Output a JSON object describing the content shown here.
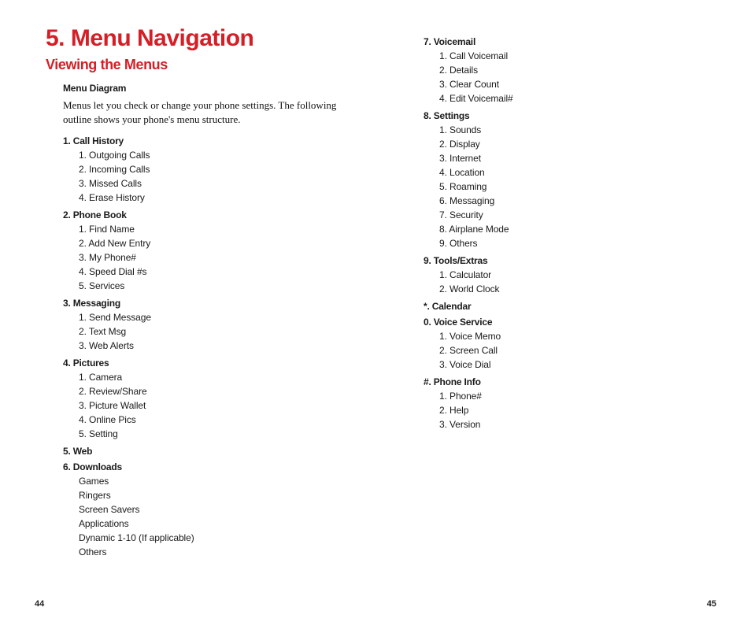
{
  "chapter_title": "5. Menu Navigation",
  "section_title": "Viewing the Menus",
  "subhead": "Menu Diagram",
  "intro": "Menus let you check or change your phone settings. The following outline shows your phone's menu structure.",
  "left_page_num": "44",
  "right_page_num": "45",
  "left_menus": [
    {
      "heading": "1. Call History",
      "items": [
        "1. Outgoing Calls",
        "2. Incoming Calls",
        "3. Missed Calls",
        "4. Erase History"
      ]
    },
    {
      "heading": "2. Phone Book",
      "items": [
        "1. Find Name",
        "2. Add New Entry",
        "3. My Phone#",
        "4. Speed Dial #s",
        "5. Services"
      ]
    },
    {
      "heading": "3. Messaging",
      "items": [
        "1. Send Message",
        "2. Text Msg",
        "3. Web Alerts"
      ]
    },
    {
      "heading": "4. Pictures",
      "items": [
        "1. Camera",
        "2. Review/Share",
        "3. Picture Wallet",
        "4. Online Pics",
        "5. Setting"
      ]
    },
    {
      "heading": "5. Web",
      "items": []
    },
    {
      "heading": "6. Downloads",
      "items": [
        "Games",
        "Ringers",
        "Screen Savers",
        "Applications",
        "Dynamic 1-10 (If applicable)",
        "Others"
      ]
    }
  ],
  "right_menus": [
    {
      "heading": "7. Voicemail",
      "items": [
        "1. Call Voicemail",
        "2. Details",
        "3. Clear Count",
        "4. Edit Voicemail#"
      ]
    },
    {
      "heading": "8. Settings",
      "items": [
        "1. Sounds",
        "2. Display",
        "3. Internet",
        "4. Location",
        "5. Roaming",
        "6. Messaging",
        "7. Security",
        "8. Airplane Mode",
        "9. Others"
      ]
    },
    {
      "heading": "9. Tools/Extras",
      "items": [
        "1. Calculator",
        "2. World Clock"
      ]
    },
    {
      "heading": "*. Calendar",
      "items": []
    },
    {
      "heading": "0. Voice Service",
      "items": [
        "1. Voice Memo",
        "2. Screen Call",
        "3. Voice Dial"
      ]
    },
    {
      "heading": "#. Phone Info",
      "items": [
        "1. Phone#",
        "2. Help",
        "3. Version"
      ]
    }
  ]
}
